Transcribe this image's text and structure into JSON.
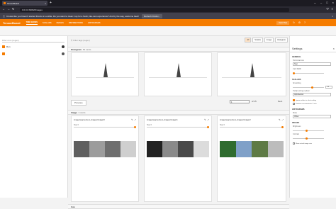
{
  "browser": {
    "tab_title": "TensorBoard",
    "url": "0.0.0.0:6006/#images",
    "notification": "It looks like you haven't started Firefox in a while. Do you want to clean it up for a fresh, like-new experience? And by the way, welcome back!",
    "notification_button": "Refresh Firefox..."
  },
  "tensorboard": {
    "brand": "TensorBoard",
    "tabs": [
      "TIME SERIES",
      "SCALARS",
      "IMAGES",
      "DISTRIBUTIONS",
      "HISTOGRAMS"
    ],
    "active_tab": "TIME SERIES",
    "status": "INACTIVE"
  },
  "runs": {
    "filter_placeholder": "Filter runs (regex)",
    "header": "Run",
    "items": [
      {
        "name": "."
      }
    ]
  },
  "main": {
    "tag_filter_placeholder": "Filter tags (regex)",
    "toggles": [
      "All",
      "Scalars",
      "Image",
      "Histogram"
    ],
    "histogram_section": {
      "title": "Histogram",
      "count": "56 cards"
    },
    "pager": {
      "prev": "Previous",
      "page": "1",
      "total": "of 15",
      "next": "Next"
    },
    "image_section": {
      "title": "Image",
      "count": "3 cards"
    },
    "image_cards": [
      {
        "title": "image/augmented_images/image/0",
        "step_label": "Step 0",
        "colors": [
          "#5f5f5f",
          "#9c9c9c",
          "#6e6e6e",
          "#cfcfcf"
        ]
      },
      {
        "title": "image/augmented_images/image/1",
        "step_label": "Step 0",
        "colors": [
          "#222",
          "#8a8a8a",
          "#4a4a4a",
          "#dcdcdc"
        ]
      },
      {
        "title": "image/augmented_images/image/2",
        "step_label": "Step 0",
        "colors": [
          "#2f6c2f",
          "#7fa0c8",
          "#5e7a45",
          "#bcbcbc"
        ]
      }
    ],
    "bottom_section": {
      "title": "loss"
    }
  },
  "settings": {
    "title": "Settings",
    "general": {
      "label": "GENERAL",
      "horizontal_axis": "Horizontal Axis",
      "horizontal_axis_value": "Step",
      "card_width": "Card Width"
    },
    "scalars": {
      "label": "SCALARS",
      "smoothing": "Smoothing",
      "smoothing_value": "0.6",
      "tooltip_label": "Tooltip sorting method",
      "tooltip_value": "Alphabetical",
      "ignore_outliers": "Ignore outliers in chart scaling",
      "partition": "Partition non-monotonic X axis"
    },
    "histograms": {
      "label": "HISTOGRAMS",
      "mode_label": "Mode",
      "mode_value": "Offset"
    },
    "images": {
      "label": "IMAGES",
      "brightness": "Brightness",
      "contrast": "Contrast",
      "actual_size": "Show actual image size"
    }
  },
  "colors": {
    "accent": "#f57c00"
  }
}
